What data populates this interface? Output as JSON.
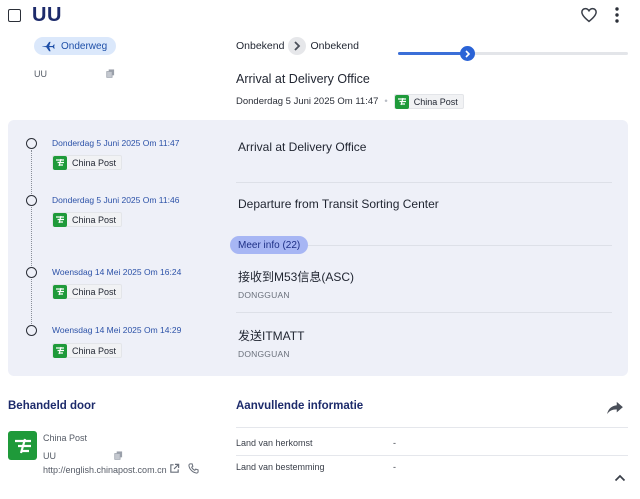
{
  "header": {
    "title": "UU",
    "icons": {
      "favorite": "heart-outline-icon",
      "menu": "kebab-menu-icon",
      "select": "checkbox-icon"
    }
  },
  "summary": {
    "status": "Onderweg",
    "status_icon": "airplane-icon",
    "tracking_number": "UU",
    "origin": "Onbekend",
    "destination": "Onbekend",
    "progress_fraction": 0.3,
    "latest_event": "Arrival at Delivery Office",
    "latest_datetime": "Donderdag 5 Juni 2025 Om 11:47",
    "latest_carrier": "China Post"
  },
  "timeline": {
    "events": [
      {
        "datetime": "Donderdag 5 Juni 2025 Om 11:47",
        "carrier": "China Post",
        "event": "Arrival at Delivery Office",
        "location": ""
      },
      {
        "datetime": "Donderdag 5 Juni 2025 Om 11:46",
        "carrier": "China Post",
        "event": "Departure from Transit Sorting Center",
        "location": ""
      },
      {
        "datetime": "Woensdag 14 Mei 2025 Om 16:24",
        "carrier": "China Post",
        "event": "接收到M53信息(ASC)",
        "location": "DONGGUAN"
      },
      {
        "datetime": "Woensdag 14 Mei 2025 Om 14:29",
        "carrier": "China Post",
        "event": "发送ITMATT",
        "location": "DONGGUAN"
      }
    ],
    "more_label": "Meer info (22)"
  },
  "handler": {
    "section_title": "Behandeld door",
    "name": "China Post",
    "tracking_number": "UU",
    "url": "http://english.chinapost.com.cn"
  },
  "additional": {
    "section_title": "Aanvullende informatie",
    "rows": [
      {
        "label": "Land van herkomst",
        "value": "-"
      },
      {
        "label": "Land van bestemming",
        "value": "-"
      }
    ]
  },
  "colors": {
    "accent": "#2a63d6",
    "title": "#1d2b6b",
    "carrier_green": "#1f9a3a",
    "panel_bg": "#eef0f8"
  }
}
